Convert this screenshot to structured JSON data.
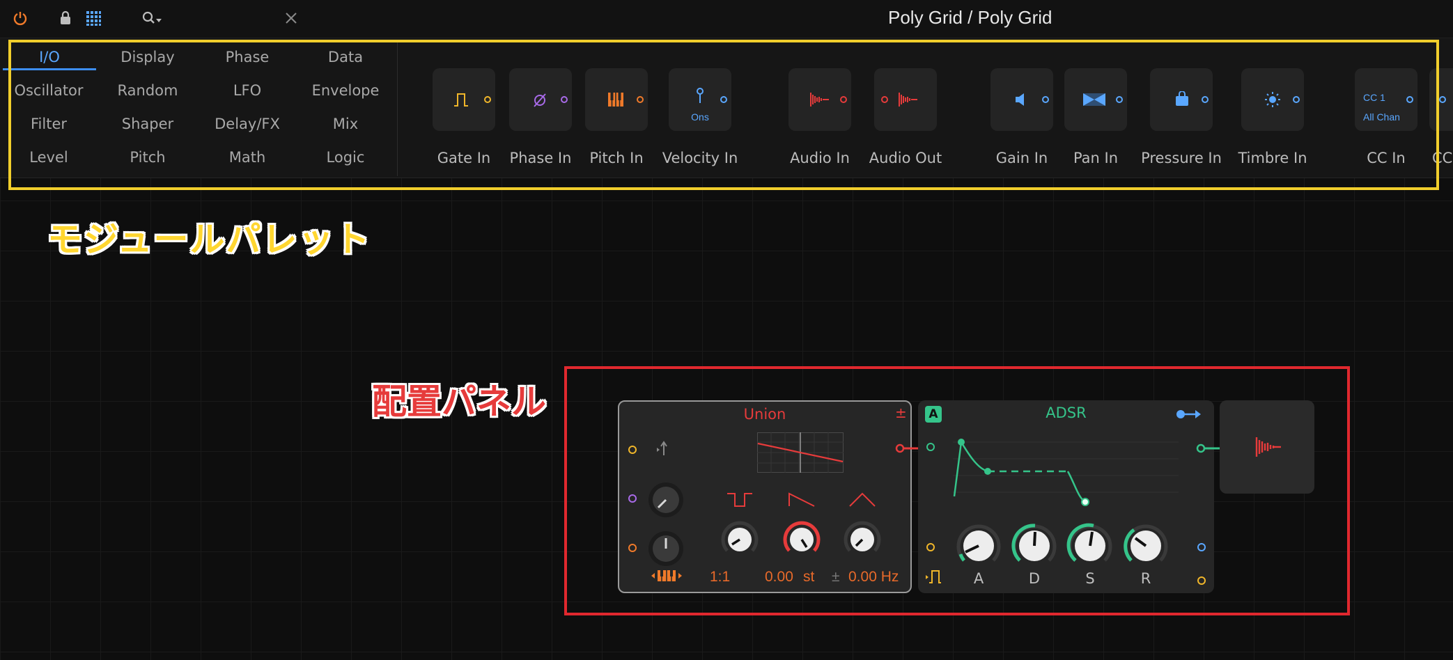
{
  "title": "Poly Grid / Poly Grid",
  "topbar": {
    "icons": [
      "power-icon",
      "lock-icon",
      "grid-icon",
      "search-filter-icon",
      "close-icon"
    ]
  },
  "palette": {
    "categories": [
      [
        "I/O",
        "Display",
        "Phase",
        "Data"
      ],
      [
        "Oscillator",
        "Random",
        "LFO",
        "Envelope"
      ],
      [
        "Filter",
        "Shaper",
        "Delay/FX",
        "Mix"
      ],
      [
        "Level",
        "Pitch",
        "Math",
        "Logic"
      ]
    ],
    "active_category": "I/O",
    "modules": [
      {
        "label": "Gate In",
        "icon": "gate-icon",
        "color": "#f0b62a"
      },
      {
        "label": "Phase In",
        "icon": "phase-icon",
        "color": "#a86ae8"
      },
      {
        "label": "Pitch In",
        "icon": "keyboard-icon",
        "color": "#f07a2a"
      },
      {
        "label": "Velocity In",
        "icon": "velocity-icon",
        "color": "#5aa7ff",
        "sub": "Ons"
      },
      {
        "label": "Audio In",
        "icon": "audio-icon",
        "color": "#e63b3b"
      },
      {
        "label": "Audio Out",
        "icon": "audio-icon",
        "color": "#e63b3b"
      },
      {
        "label": "Gain In",
        "icon": "speaker-icon",
        "color": "#5aa7ff"
      },
      {
        "label": "Pan In",
        "icon": "pan-icon",
        "color": "#5aa7ff"
      },
      {
        "label": "Pressure In",
        "icon": "pressure-icon",
        "color": "#5aa7ff"
      },
      {
        "label": "Timbre In",
        "icon": "sun-icon",
        "color": "#5aa7ff"
      },
      {
        "label": "CC In",
        "icon": "cc-icon",
        "color": "#5aa7ff",
        "sub_top": "CC 1",
        "sub": "All Chan"
      },
      {
        "label": "CC",
        "icon": "cc-icon",
        "color": "#5aa7ff"
      }
    ],
    "caption": "モジュールパレット"
  },
  "panel": {
    "caption": "配置パネル",
    "union": {
      "title": "Union",
      "plus": "±",
      "ratio": "1:1",
      "semitones": "0.00",
      "semitones_unit": "st",
      "offset_sign": "±",
      "hz": "0.00 Hz",
      "hz_display": "0.00 Hz",
      "waveforms": [
        "pulse-wave-icon",
        "saw-wave-icon",
        "triangle-wave-icon"
      ]
    },
    "adsr": {
      "badge": "A",
      "title": "ADSR",
      "knob_labels": [
        "A",
        "D",
        "S",
        "R"
      ]
    },
    "colors": {
      "accent_blue": "#5aa7ff",
      "union_red": "#e63b3b",
      "adsr_green": "#35c48a",
      "value_orange": "#e86a2a",
      "palette_frame": "#f1ce2c",
      "panel_frame": "#e0282e"
    }
  }
}
